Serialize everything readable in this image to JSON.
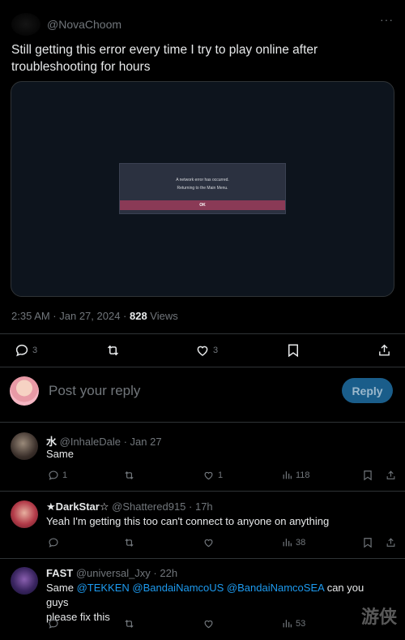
{
  "main_tweet": {
    "handle": "@NovaChoom",
    "more": "···",
    "text": "Still getting this error every time I try to play online after troubleshooting for hours",
    "media": {
      "line1": "A network error has occurred.",
      "line2": "Returning to the Main Menu.",
      "ok": "OK"
    },
    "time": "2:35 AM · Jan 27, 2024 · ",
    "views_count": "828",
    "views_label": " Views",
    "actions": {
      "replies": "3",
      "likes": "3"
    }
  },
  "composer": {
    "placeholder": "Post your reply",
    "button": "Reply"
  },
  "replies": [
    {
      "name": "水",
      "handle": "@InhaleDale",
      "date": " · Jan 27",
      "text": "Same",
      "reply_count": "1",
      "like_count": "1",
      "views": "118"
    },
    {
      "name": "★DarkStar☆",
      "handle": "@Shattered915",
      "date": " · 17h",
      "text": "Yeah I'm getting this too can't connect to anyone on anything",
      "reply_count": "",
      "like_count": "",
      "views": "38"
    },
    {
      "name": "FAST",
      "handle": "@universal_Jxy",
      "date": " · 22h",
      "text_pre": "Same ",
      "mentions": "@TEKKEN @BandaiNamcoUS @BandaiNamcoSEA",
      "text_post": " can you guys",
      "text_line2": "please fix this",
      "reply_count": "",
      "like_count": "",
      "views": "53"
    }
  ],
  "watermark": "游侠"
}
